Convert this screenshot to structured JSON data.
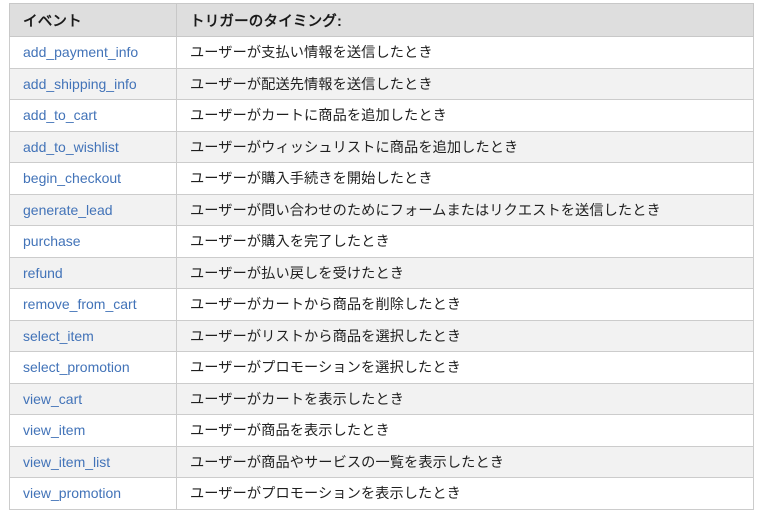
{
  "table": {
    "columns": [
      {
        "key": "event",
        "label": "イベント"
      },
      {
        "key": "trigger",
        "label": "トリガーのタイミング:"
      }
    ],
    "accent_link_color": "#4273b8",
    "header_background": "#dedede",
    "stripe_background": "#f2f2f2",
    "row_background": "#ffffff",
    "border_color": "#cccccc",
    "row_count": 14,
    "rows": [
      {
        "event": "add_payment_info",
        "trigger": "ユーザーが支払い情報を送信したとき"
      },
      {
        "event": "add_shipping_info",
        "trigger": "ユーザーが配送先情報を送信したとき"
      },
      {
        "event": "add_to_cart",
        "trigger": "ユーザーがカートに商品を追加したとき"
      },
      {
        "event": "add_to_wishlist",
        "trigger": "ユーザーがウィッシュリストに商品を追加したとき"
      },
      {
        "event": "begin_checkout",
        "trigger": "ユーザーが購入手続きを開始したとき"
      },
      {
        "event": "generate_lead",
        "trigger": "ユーザーが問い合わせのためにフォームまたはリクエストを送信したとき"
      },
      {
        "event": "purchase",
        "trigger": "ユーザーが購入を完了したとき"
      },
      {
        "event": "refund",
        "trigger": "ユーザーが払い戻しを受けたとき"
      },
      {
        "event": "remove_from_cart",
        "trigger": "ユーザーがカートから商品を削除したとき"
      },
      {
        "event": "select_item",
        "trigger": "ユーザーがリストから商品を選択したとき"
      },
      {
        "event": "select_promotion",
        "trigger": "ユーザーがプロモーションを選択したとき"
      },
      {
        "event": "view_cart",
        "trigger": "ユーザーがカートを表示したとき"
      },
      {
        "event": "view_item",
        "trigger": "ユーザーが商品を表示したとき"
      },
      {
        "event": "view_item_list",
        "trigger": "ユーザーが商品やサービスの一覧を表示したとき"
      },
      {
        "event": "view_promotion",
        "trigger": "ユーザーがプロモーションを表示したとき"
      }
    ]
  }
}
